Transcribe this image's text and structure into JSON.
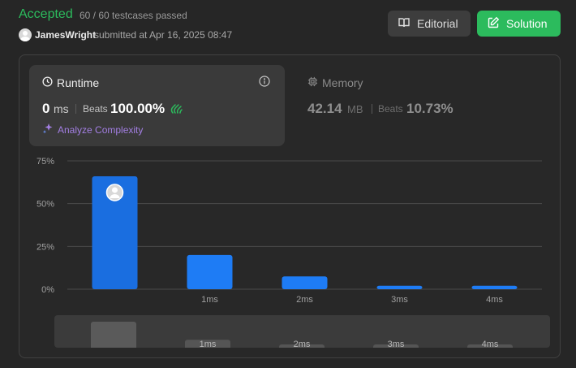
{
  "result": {
    "status": "Accepted",
    "testcases": "60 / 60 testcases passed",
    "user": "JamesWright",
    "submitted": "submitted at Apr 16, 2025 08:47"
  },
  "buttons": {
    "editorial": "Editorial",
    "solution": "Solution"
  },
  "runtime": {
    "title": "Runtime",
    "value": "0",
    "unit": "ms",
    "beats_label": "Beats",
    "beats": "100.00%",
    "analyze": "Analyze Complexity"
  },
  "memory": {
    "title": "Memory",
    "value": "42.14",
    "unit": "MB",
    "beats_label": "Beats",
    "beats": "10.73%"
  },
  "colors": {
    "accent": "#2cbb5d",
    "bar": "#1e7cf5",
    "bar_active": "#1a6ee0",
    "analyze": "#a37fe3"
  },
  "chart_data": {
    "type": "bar",
    "categories": [
      "0ms",
      "1ms",
      "2ms",
      "3ms",
      "4ms"
    ],
    "tick_labels": [
      "",
      "1ms",
      "2ms",
      "3ms",
      "4ms"
    ],
    "values": [
      66,
      20,
      7.5,
      2,
      2
    ],
    "ylim": [
      0,
      75
    ],
    "yticks": [
      "0%",
      "25%",
      "50%",
      "75%"
    ],
    "ytick_values": [
      0,
      25,
      50,
      75
    ],
    "highlight_index": 0,
    "grid": true,
    "navigator_labels": [
      "",
      "1ms",
      "2ms",
      "3ms",
      "4ms"
    ]
  }
}
